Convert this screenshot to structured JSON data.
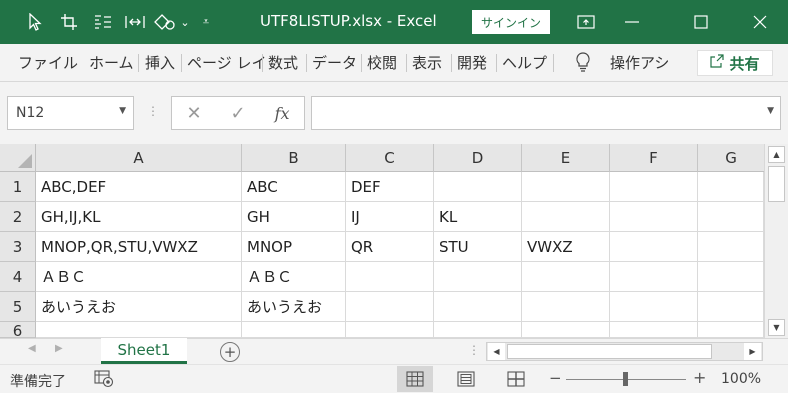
{
  "title_bar": {
    "title": "UTF8LISTUP.xlsx  -  Excel",
    "signin": "サインイン",
    "qat_icons": [
      "pointer-icon",
      "crop-icon",
      "list-format-icon",
      "text-spacing-icon",
      "shapes-icon",
      "customize-qat-icon"
    ],
    "window_controls": [
      "ribbon-display-icon",
      "minimize-icon",
      "maximize-icon",
      "close-icon"
    ],
    "accent_color": "#217346"
  },
  "ribbon": {
    "tabs": [
      "ファイル",
      "ホーム",
      "挿入",
      "ページ レイ",
      "数式",
      "データ",
      "校閲",
      "表示",
      "開発",
      "ヘルプ"
    ],
    "tell_me": "操作アシ",
    "share": "共有"
  },
  "formula_bar": {
    "name_box": "N12",
    "fx_label": "fx",
    "formula": ""
  },
  "sheet": {
    "columns": [
      "A",
      "B",
      "C",
      "D",
      "E",
      "F",
      "G"
    ],
    "rows": [
      {
        "num": "1",
        "cells": [
          "ABC,DEF",
          "ABC",
          "DEF",
          "",
          "",
          "",
          ""
        ]
      },
      {
        "num": "2",
        "cells": [
          "GH,IJ,KL",
          "GH",
          "IJ",
          "KL",
          "",
          "",
          ""
        ]
      },
      {
        "num": "3",
        "cells": [
          "MNOP,QR,STU,VWXZ",
          "MNOP",
          "QR",
          "STU",
          "VWXZ",
          "",
          ""
        ]
      },
      {
        "num": "4",
        "cells": [
          "ＡＢＣ",
          "ＡＢＣ",
          "",
          "",
          "",
          "",
          ""
        ]
      },
      {
        "num": "5",
        "cells": [
          "あいうえお",
          "あいうえお",
          "",
          "",
          "",
          "",
          ""
        ]
      },
      {
        "num": "6",
        "cells": [
          "",
          "",
          "",
          "",
          "",
          "",
          ""
        ]
      }
    ]
  },
  "sheet_tabs": {
    "tabs": [
      "Sheet1"
    ],
    "active": "Sheet1"
  },
  "status_bar": {
    "status": "準備完了",
    "zoom": "100%",
    "zoom_level_percent": 100
  }
}
